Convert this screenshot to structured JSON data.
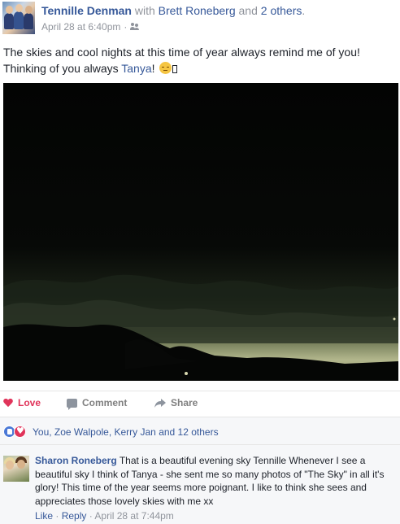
{
  "post": {
    "author": "Tennille Denman",
    "with_word": "with",
    "tagged_person": "Brett Roneberg",
    "and_word": "and",
    "others": "2 others",
    "period": ".",
    "timestamp": "April 28 at 6:40pm",
    "separator": "·",
    "audience_icon": "friends-icon",
    "message_part1": "The skies and cool nights at this time of year always remind me of you! Thinking of you always ",
    "message_mention": "Tanya",
    "message_part2": "! ",
    "photo_alt": "night sky photo"
  },
  "actions": {
    "love": "Love",
    "comment": "Comment",
    "share": "Share"
  },
  "reactions": {
    "summary": "You, Zoe Walpole, Kerry Jan and 12 others"
  },
  "comment": {
    "author": "Sharon Roneberg",
    "text": "That is a beautiful evening sky Tennille Whenever I see a beautiful sky I think of Tanya - she sent me so many photos of \"The Sky\" in all it's glory! This time of the year seems more poignant. I like to think she sees and appreciates those lovely skies with me xx",
    "like": "Like",
    "reply": "Reply",
    "dot": "·",
    "timestamp": "April 28 at 7:44pm"
  },
  "colors": {
    "link": "#365899",
    "love": "#e0345a",
    "muted": "#90949c"
  }
}
